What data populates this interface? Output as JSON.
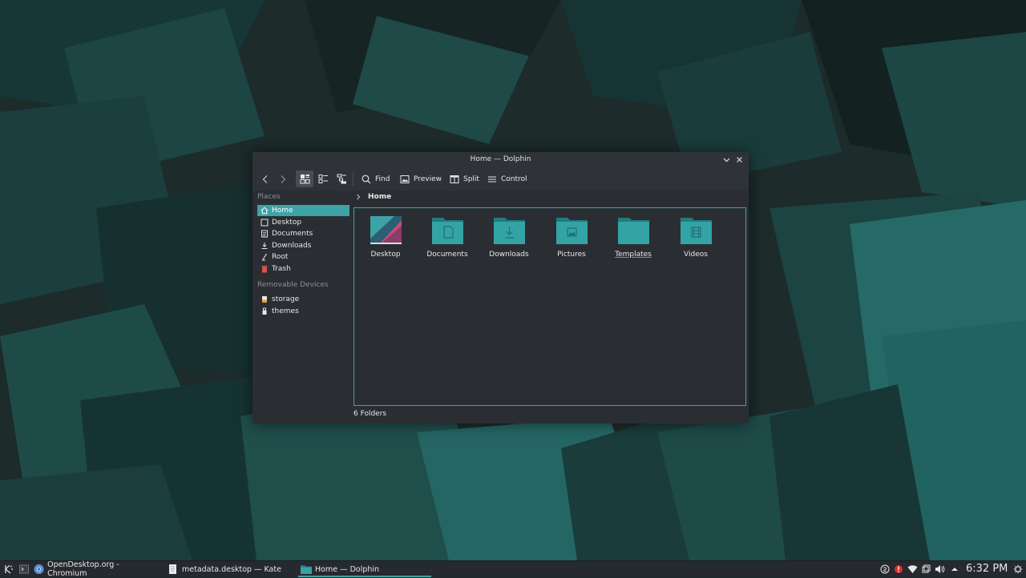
{
  "window": {
    "title": "Home — Dolphin"
  },
  "toolbar": {
    "find_label": "Find",
    "preview_label": "Preview",
    "split_label": "Split",
    "control_label": "Control"
  },
  "sidebar": {
    "places_header": "Places",
    "places": [
      {
        "label": "Home",
        "icon": "home-icon",
        "active": true
      },
      {
        "label": "Desktop",
        "icon": "desktop-icon"
      },
      {
        "label": "Documents",
        "icon": "documents-icon"
      },
      {
        "label": "Downloads",
        "icon": "downloads-icon"
      },
      {
        "label": "Root",
        "icon": "root-icon"
      },
      {
        "label": "Trash",
        "icon": "trash-icon"
      }
    ],
    "removable_header": "Removable Devices",
    "removable": [
      {
        "label": "storage",
        "icon": "drive-icon"
      },
      {
        "label": "themes",
        "icon": "usb-icon"
      }
    ]
  },
  "breadcrumb": {
    "current": "Home"
  },
  "folders": [
    {
      "label": "Desktop",
      "icon": "desktop-folder-icon"
    },
    {
      "label": "Documents",
      "icon": "documents-folder-icon"
    },
    {
      "label": "Downloads",
      "icon": "downloads-folder-icon"
    },
    {
      "label": "Pictures",
      "icon": "pictures-folder-icon"
    },
    {
      "label": "Templates",
      "icon": "templates-folder-icon"
    },
    {
      "label": "Videos",
      "icon": "videos-folder-icon"
    }
  ],
  "status": {
    "text": "6 Folders"
  },
  "taskbar": {
    "tasks": [
      {
        "label": "OpenDesktop.org - Chromium",
        "icon": "chromium-icon"
      },
      {
        "label": "metadata.desktop  — Kate",
        "icon": "kate-icon"
      },
      {
        "label": "Home — Dolphin",
        "icon": "dolphin-icon",
        "active": true
      }
    ],
    "clock": "6:32 PM"
  },
  "colors": {
    "accent": "#3ea3a7",
    "window_bg": "#2a2e32",
    "titlebar_bg": "#2f3338",
    "taskbar_bg": "#26292d"
  }
}
